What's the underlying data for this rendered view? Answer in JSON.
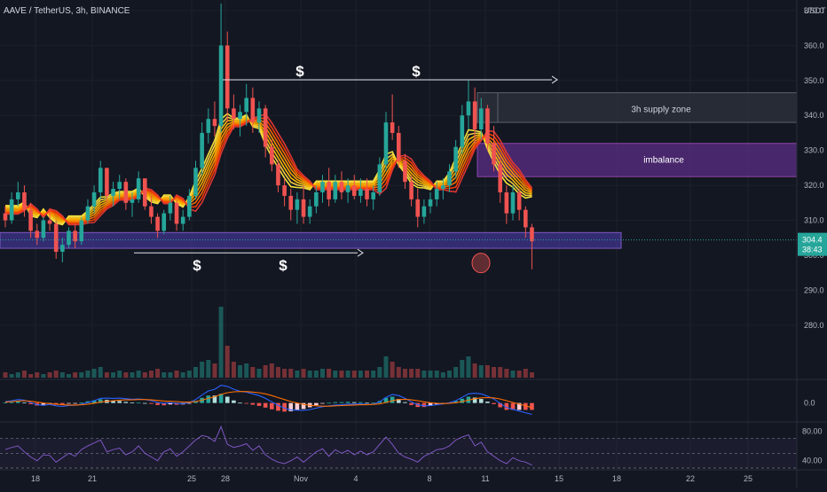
{
  "header": {
    "symbol": "AAVE / TetherUS, 3h, BINANCE",
    "currency": "USDT"
  },
  "colors": {
    "background": "#131722",
    "bull": "#26a69a",
    "bear": "#ef5350",
    "grid": "#1c202b",
    "axis_text": "#b2b5be",
    "zone_fill": "#5b2d86",
    "support_fill": "#4a3aa6",
    "price_badge": "#26a69a",
    "macd_line": "#2962ff",
    "signal_line": "#ff6d00",
    "rsi_line": "#7e57c2"
  },
  "chart_data": [
    {
      "type": "candlestick",
      "title": "AAVE / TetherUS, 3h, BINANCE",
      "ylabel": "USDT",
      "ylim": [
        265,
        372
      ],
      "y_ticks": [
        "370.0",
        "360.0",
        "350.0",
        "340.0",
        "330.0",
        "320.0",
        "310.0",
        "290.0",
        "280.0"
      ],
      "x_ticks": [
        "18",
        "21",
        "25",
        "28",
        "Nov",
        "4",
        "8",
        "11",
        "15",
        "18",
        "22",
        "25"
      ],
      "last_price": "304.4",
      "countdown": "38:43",
      "partial_tick": "300.0",
      "ohlc": [
        [
          312,
          314,
          308,
          310
        ],
        [
          310,
          318,
          309,
          316
        ],
        [
          316,
          321,
          314,
          318
        ],
        [
          318,
          320,
          311,
          313
        ],
        [
          313,
          315,
          305,
          307
        ],
        [
          307,
          309,
          303,
          305
        ],
        [
          305,
          311,
          304,
          310
        ],
        [
          310,
          313,
          307,
          309
        ],
        [
          309,
          310,
          299,
          301
        ],
        [
          301,
          305,
          298,
          303
        ],
        [
          303,
          308,
          302,
          307
        ],
        [
          307,
          309,
          302,
          304
        ],
        [
          304,
          311,
          303,
          310
        ],
        [
          310,
          316,
          309,
          314
        ],
        [
          314,
          320,
          312,
          318
        ],
        [
          318,
          327,
          316,
          325
        ],
        [
          325,
          324,
          315,
          317
        ],
        [
          317,
          321,
          314,
          319
        ],
        [
          319,
          323,
          316,
          321
        ],
        [
          321,
          322,
          313,
          315
        ],
        [
          315,
          318,
          311,
          316
        ],
        [
          316,
          324,
          315,
          322
        ],
        [
          322,
          320,
          313,
          314
        ],
        [
          314,
          317,
          309,
          311
        ],
        [
          311,
          312,
          305,
          307
        ],
        [
          307,
          313,
          306,
          312
        ],
        [
          312,
          317,
          310,
          315
        ],
        [
          315,
          316,
          307,
          309
        ],
        [
          309,
          313,
          307,
          311
        ],
        [
          311,
          319,
          310,
          317
        ],
        [
          317,
          327,
          316,
          325
        ],
        [
          325,
          338,
          323,
          335
        ],
        [
          335,
          342,
          332,
          339
        ],
        [
          339,
          344,
          334,
          337
        ],
        [
          337,
          372,
          335,
          360
        ],
        [
          360,
          364,
          338,
          342
        ],
        [
          342,
          346,
          336,
          339
        ],
        [
          339,
          343,
          334,
          341
        ],
        [
          341,
          349,
          337,
          345
        ],
        [
          345,
          348,
          335,
          338
        ],
        [
          338,
          344,
          335,
          342
        ],
        [
          342,
          343,
          328,
          331
        ],
        [
          331,
          333,
          324,
          326
        ],
        [
          326,
          327,
          318,
          320
        ],
        [
          320,
          322,
          314,
          317
        ],
        [
          317,
          319,
          310,
          313
        ],
        [
          313,
          318,
          309,
          316
        ],
        [
          316,
          320,
          309,
          311
        ],
        [
          311,
          316,
          309,
          314
        ],
        [
          314,
          320,
          312,
          318
        ],
        [
          318,
          323,
          315,
          321
        ],
        [
          321,
          325,
          314,
          316
        ],
        [
          316,
          323,
          315,
          321
        ],
        [
          321,
          324,
          316,
          318
        ],
        [
          318,
          322,
          315,
          320
        ],
        [
          320,
          323,
          316,
          317
        ],
        [
          317,
          322,
          315,
          319
        ],
        [
          319,
          322,
          314,
          316
        ],
        [
          316,
          320,
          313,
          318
        ],
        [
          318,
          328,
          317,
          326
        ],
        [
          326,
          341,
          324,
          338
        ],
        [
          338,
          346,
          333,
          335
        ],
        [
          335,
          337,
          325,
          327
        ],
        [
          327,
          329,
          319,
          321
        ],
        [
          321,
          323,
          314,
          316
        ],
        [
          316,
          319,
          308,
          311
        ],
        [
          311,
          316,
          309,
          314
        ],
        [
          314,
          318,
          312,
          316
        ],
        [
          316,
          321,
          314,
          319
        ],
        [
          319,
          322,
          316,
          320
        ],
        [
          320,
          326,
          318,
          324
        ],
        [
          324,
          333,
          322,
          331
        ],
        [
          331,
          343,
          329,
          340
        ],
        [
          340,
          350,
          336,
          344
        ],
        [
          344,
          348,
          332,
          336
        ],
        [
          336,
          345,
          333,
          342
        ],
        [
          342,
          343,
          330,
          332
        ],
        [
          332,
          337,
          324,
          326
        ],
        [
          326,
          328,
          315,
          318
        ],
        [
          318,
          320,
          309,
          312
        ],
        [
          312,
          320,
          310,
          318
        ],
        [
          318,
          319,
          310,
          313
        ],
        [
          313,
          314,
          305,
          308
        ],
        [
          308,
          309,
          296,
          304
        ]
      ],
      "volume": [
        3,
        2,
        3,
        4,
        2,
        3,
        2,
        3,
        4,
        3,
        2,
        3,
        3,
        4,
        5,
        6,
        3,
        3,
        4,
        3,
        3,
        4,
        3,
        4,
        5,
        3,
        3,
        4,
        3,
        4,
        6,
        9,
        10,
        8,
        40,
        18,
        9,
        7,
        8,
        6,
        5,
        7,
        8,
        6,
        5,
        5,
        4,
        5,
        4,
        4,
        5,
        5,
        4,
        4,
        4,
        4,
        4,
        4,
        4,
        6,
        12,
        9,
        6,
        5,
        5,
        5,
        4,
        4,
        4,
        3,
        4,
        6,
        10,
        12,
        8,
        7,
        7,
        6,
        6,
        5,
        4,
        4,
        5,
        3
      ],
      "ribbon_value": [
        313,
        313,
        313,
        314,
        313,
        312,
        312,
        312,
        311,
        310,
        310,
        310,
        310,
        311,
        312,
        314,
        315,
        316,
        317,
        317,
        317,
        318,
        318,
        317,
        316,
        316,
        316,
        316,
        315,
        315,
        317,
        320,
        324,
        328,
        334,
        337,
        338,
        338,
        339,
        338,
        338,
        336,
        333,
        330,
        327,
        324,
        322,
        321,
        320,
        320,
        320,
        320,
        320,
        320,
        320,
        320,
        320,
        320,
        320,
        321,
        324,
        327,
        327,
        326,
        324,
        322,
        321,
        320,
        320,
        320,
        321,
        323,
        327,
        331,
        333,
        334,
        333,
        331,
        328,
        325,
        323,
        321,
        319,
        318
      ]
    },
    {
      "type": "line",
      "title": "MACD",
      "y_ticks": [
        "0.0"
      ],
      "series": [
        {
          "values": [
            0.5,
            0.8,
            1.2,
            1.0,
            0.2,
            -0.6,
            -0.8,
            -0.5,
            -1.0,
            -1.2,
            -0.9,
            -0.8,
            -0.4,
            0.2,
            0.8,
            1.6,
            1.7,
            1.6,
            1.7,
            1.5,
            1.3,
            1.4,
            1.2,
            0.8,
            0.2,
            -0.1,
            0.1,
            -0.1,
            -0.2,
            0.2,
            1.2,
            2.8,
            4.2,
            4.8,
            6.2,
            5.8,
            4.8,
            4.1,
            3.8,
            3.2,
            2.6,
            1.6,
            0.4,
            -0.8,
            -1.8,
            -2.4,
            -2.5,
            -2.6,
            -2.3,
            -1.8,
            -1.3,
            -1.0,
            -0.7,
            -0.6,
            -0.4,
            -0.4,
            -0.3,
            -0.5,
            -0.4,
            0.4,
            2.0,
            3.0,
            2.6,
            1.6,
            0.4,
            -0.6,
            -1.0,
            -0.9,
            -0.6,
            -0.3,
            0.1,
            0.8,
            2.0,
            3.2,
            3.4,
            3.2,
            2.4,
            1.4,
            -0.1,
            -1.6,
            -2.2,
            -2.8,
            -3.4,
            -4.0
          ]
        },
        {
          "values": [
            0.3,
            0.5,
            0.7,
            0.8,
            0.6,
            0.3,
            0.0,
            -0.2,
            -0.4,
            -0.6,
            -0.7,
            -0.7,
            -0.6,
            -0.4,
            -0.1,
            0.3,
            0.6,
            0.8,
            1.0,
            1.1,
            1.1,
            1.2,
            1.2,
            1.1,
            0.9,
            0.7,
            0.6,
            0.5,
            0.3,
            0.3,
            0.5,
            1.0,
            1.6,
            2.2,
            3.0,
            3.6,
            3.9,
            4.0,
            4.0,
            3.8,
            3.6,
            3.2,
            2.6,
            1.9,
            1.2,
            0.5,
            0.0,
            -0.5,
            -0.8,
            -1.0,
            -1.1,
            -1.1,
            -1.0,
            -0.9,
            -0.8,
            -0.7,
            -0.6,
            -0.6,
            -0.5,
            -0.3,
            0.2,
            0.8,
            1.2,
            1.3,
            1.1,
            0.8,
            0.4,
            0.1,
            -0.1,
            -0.2,
            -0.1,
            0.1,
            0.5,
            1.0,
            1.5,
            1.8,
            1.9,
            1.8,
            1.4,
            0.8,
            0.2,
            -0.4,
            -1.0,
            -1.6
          ]
        }
      ]
    },
    {
      "type": "line",
      "title": "RSI",
      "y_ticks": [
        "80.00",
        "40.00"
      ],
      "series": [
        {
          "values": [
            55,
            58,
            60,
            52,
            45,
            40,
            48,
            47,
            38,
            44,
            50,
            46,
            55,
            60,
            64,
            68,
            52,
            55,
            57,
            48,
            52,
            60,
            50,
            45,
            40,
            52,
            56,
            46,
            52,
            60,
            68,
            74,
            72,
            66,
            86,
            62,
            58,
            60,
            63,
            54,
            60,
            48,
            42,
            38,
            36,
            40,
            45,
            38,
            45,
            52,
            56,
            46,
            55,
            50,
            54,
            48,
            53,
            48,
            52,
            62,
            72,
            62,
            50,
            45,
            42,
            38,
            46,
            50,
            55,
            56,
            60,
            68,
            72,
            75,
            60,
            65,
            52,
            46,
            40,
            36,
            44,
            40,
            38,
            34
          ]
        }
      ]
    }
  ],
  "annotations": {
    "supply_zone_label": "3h supply zone",
    "imbalance_label": "imbalance",
    "liquidity_markers": [
      "$",
      "$",
      "$",
      "$"
    ]
  }
}
